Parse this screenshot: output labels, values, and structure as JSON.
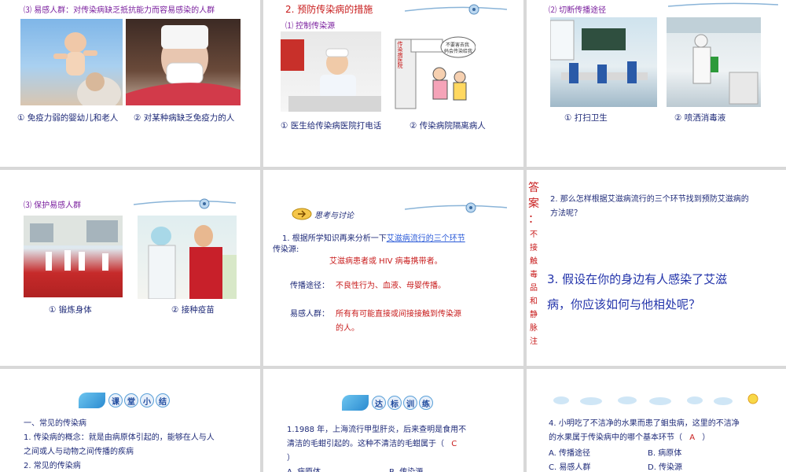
{
  "slide1": {
    "heading_num": "⑶",
    "heading": "易感人群：对传染病缺乏抵抗能力而容易感染的人群",
    "cap1": "① 免疫力弱的婴幼儿和老人",
    "cap2": "② 对某种病缺乏免疫力的人"
  },
  "slide2": {
    "title": "2. 预防传染病的措施",
    "sub": "⑴ 控制传染源",
    "cap1": "① 医生给传染病医院打电话",
    "cap2": "② 传染病院隔离病人",
    "sign": "传染病医院",
    "speech1": "不要害去我",
    "speech2": "妈会传染给我"
  },
  "slide3": {
    "heading": "⑵ 切断传播途径",
    "cap1": "① 打扫卫生",
    "cap2": "② 喷洒消毒液"
  },
  "slide4": {
    "heading": "⑶ 保护易感人群",
    "cap1": "① 锻炼身体",
    "cap2": "② 接种疫苗"
  },
  "slide5": {
    "badge": "思考与讨论",
    "q_prefix": "1. 根据所学知识再来分析一下",
    "q_link": "艾滋病流行的三个环节",
    "label_source": "传染源:",
    "ans_source": "艾滋病患者或 HIV 病毒携带者。",
    "label_route": "传播途径：",
    "ans_route": "不良性行为、血液、母婴传播。",
    "label_people": "易感人群：",
    "ans_people_1": "所有有可能直接或间接接触到传染源",
    "ans_people_2": "的人。"
  },
  "slide6": {
    "answer_chars": [
      "答",
      "案",
      "："
    ],
    "answer_body": [
      "不",
      "接",
      "触",
      "毒",
      "品",
      "和",
      "静",
      "脉",
      "注"
    ],
    "q2_line1": "2. 那么怎样根据艾滋病流行的三个环节找到预防艾滋病的",
    "q2_line2": "方法呢？",
    "q3_line1": "3. 假设在你的身边有人感染了艾滋",
    "q3_line2": "病，你应该如何与他相处呢？"
  },
  "slide7": {
    "badge_chars": [
      "课",
      "堂",
      "小",
      "结"
    ],
    "line1": "一、常见的传染病",
    "line2": "1. 传染病的概念：就是由病原体引起的，能够在人与人",
    "line3": "之间或人与动物之间传播的疾病",
    "line4": "2. 常见的传染病"
  },
  "slide8": {
    "badge_chars": [
      "达",
      "标",
      "训",
      "练"
    ],
    "line1": "1.1988 年，上海流行甲型肝炎，后来查明是食用不",
    "line2": "清洁的毛蚶引起的。这种不清洁的毛蚶属于（",
    "answer": "C",
    "line3": "）",
    "opt_a": "A. 病原体",
    "opt_b": "B. 传染源"
  },
  "slide9": {
    "q_line1": "4. 小明吃了不洁净的水果而患了蛔虫病，这里的不洁净",
    "q_line2_a": "的水果属于传染病中的哪个基本环节（",
    "answer": "A",
    "q_line2_b": "）",
    "opt_a": "A. 传播途径",
    "opt_b": "B. 病原体",
    "opt_c": "C. 易感人群",
    "opt_d": "D. 传染源"
  }
}
